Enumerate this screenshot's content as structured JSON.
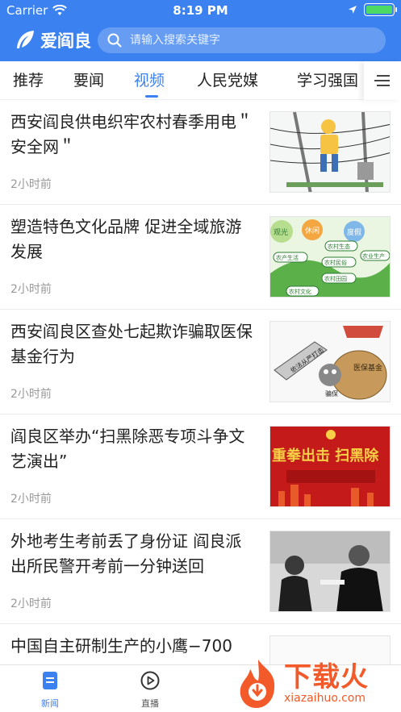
{
  "status_bar": {
    "carrier": "Carrier",
    "time": "8:19 PM"
  },
  "header": {
    "app_name": "爱阎良",
    "search_placeholder": "请输入搜索关键字"
  },
  "tabs": [
    {
      "label": "推荐",
      "active": false
    },
    {
      "label": "要闻",
      "active": false
    },
    {
      "label": "视频",
      "active": true
    },
    {
      "label": "人民党媒",
      "active": false
    },
    {
      "label": "学习强国",
      "active": false
    }
  ],
  "news": [
    {
      "title": "西安阎良供电织牢农村春季用电＂安全网＂",
      "time": "2小时前",
      "thumb": "line-worker-cartoon"
    },
    {
      "title": "塑造特色文化品牌 促进全域旅游发展",
      "time": "2小时前",
      "thumb": "culture-tourism-illustration",
      "thumb_labels": [
        "观光",
        "休闲",
        "度假",
        "农村生态",
        "农产生活",
        "农村民俗",
        "农业生产",
        "农村田园",
        "农村文化"
      ]
    },
    {
      "title": "西安阎良区查处七起欺诈骗取医保基金行为",
      "time": "2小时前",
      "thumb": "medical-insurance-cartoon",
      "thumb_labels": [
        "依法从严打击",
        "医保基金",
        "骗保"
      ]
    },
    {
      "title": "阎良区举办“扫黑除恶专项斗争文艺演出”",
      "time": "2小时前",
      "thumb": "red-banner-poster",
      "thumb_labels": [
        "重拳出击 扫黑除"
      ]
    },
    {
      "title": "外地考生考前丢了身份证 阎良派出所民警开考前一分钟送回",
      "time": "2小时前",
      "thumb": "police-photo"
    },
    {
      "title": "中国自主研制生产的小鹰−700",
      "time": "",
      "thumb": "blank"
    }
  ],
  "bottom_bar": [
    {
      "label": "新闻",
      "icon": "news-icon",
      "active": true
    },
    {
      "label": "直播",
      "icon": "play-icon",
      "active": false
    }
  ],
  "watermark": {
    "main": "下载火",
    "sub": "xiazaihuo.com"
  },
  "colors": {
    "brand": "#3b82f0",
    "watermark": "#f25a29"
  }
}
